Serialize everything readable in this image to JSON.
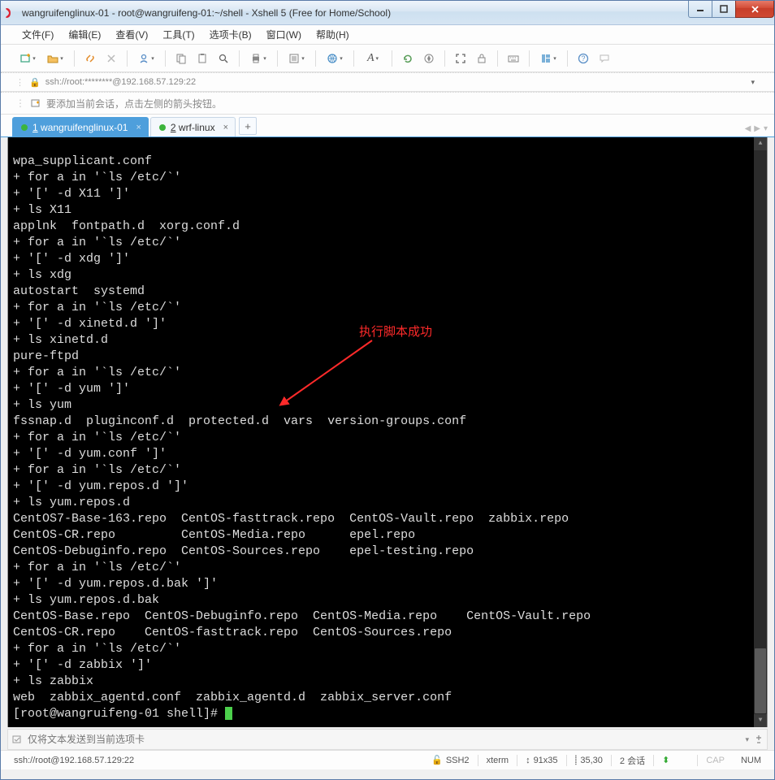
{
  "window": {
    "title": "wangruifenglinux-01 - root@wangruifeng-01:~/shell - Xshell 5 (Free for Home/School)"
  },
  "menu": {
    "file": "文件(F)",
    "edit": "编辑(E)",
    "view": "查看(V)",
    "tools": "工具(T)",
    "tabs": "选项卡(B)",
    "window": "窗口(W)",
    "help": "帮助(H)"
  },
  "address": {
    "url": "ssh://root:********@192.168.57.129:22"
  },
  "infobar": {
    "hint": "要添加当前会话，点击左侧的箭头按钮。"
  },
  "tabs": {
    "tab1": {
      "num": "1",
      "label": " wangruifenglinux-01"
    },
    "tab2": {
      "num": "2",
      "label": " wrf-linux"
    }
  },
  "terminal": {
    "lines": "wpa_supplicant.conf\n+ for a in '`ls /etc/`'\n+ '[' -d X11 ']'\n+ ls X11\napplnk  fontpath.d  xorg.conf.d\n+ for a in '`ls /etc/`'\n+ '[' -d xdg ']'\n+ ls xdg\nautostart  systemd\n+ for a in '`ls /etc/`'\n+ '[' -d xinetd.d ']'\n+ ls xinetd.d\npure-ftpd\n+ for a in '`ls /etc/`'\n+ '[' -d yum ']'\n+ ls yum\nfssnap.d  pluginconf.d  protected.d  vars  version-groups.conf\n+ for a in '`ls /etc/`'\n+ '[' -d yum.conf ']'\n+ for a in '`ls /etc/`'\n+ '[' -d yum.repos.d ']'\n+ ls yum.repos.d\nCentOS7-Base-163.repo  CentOS-fasttrack.repo  CentOS-Vault.repo  zabbix.repo\nCentOS-CR.repo         CentOS-Media.repo      epel.repo\nCentOS-Debuginfo.repo  CentOS-Sources.repo    epel-testing.repo\n+ for a in '`ls /etc/`'\n+ '[' -d yum.repos.d.bak ']'\n+ ls yum.repos.d.bak\nCentOS-Base.repo  CentOS-Debuginfo.repo  CentOS-Media.repo    CentOS-Vault.repo\nCentOS-CR.repo    CentOS-fasttrack.repo  CentOS-Sources.repo\n+ for a in '`ls /etc/`'\n+ '[' -d zabbix ']'\n+ ls zabbix\nweb  zabbix_agentd.conf  zabbix_agentd.d  zabbix_server.conf",
    "prompt": "[root@wangruifeng-01 shell]# "
  },
  "annotation": {
    "text": "执行脚本成功"
  },
  "sendbar": {
    "placeholder": "仅将文本发送到当前选项卡"
  },
  "status": {
    "conn": "ssh://root@192.168.57.129:22",
    "proto": "SSH2",
    "term": "xterm",
    "size": "91x35",
    "cursor": "35,30",
    "sessions": "2 会话",
    "cap": "CAP",
    "num": "NUM"
  }
}
